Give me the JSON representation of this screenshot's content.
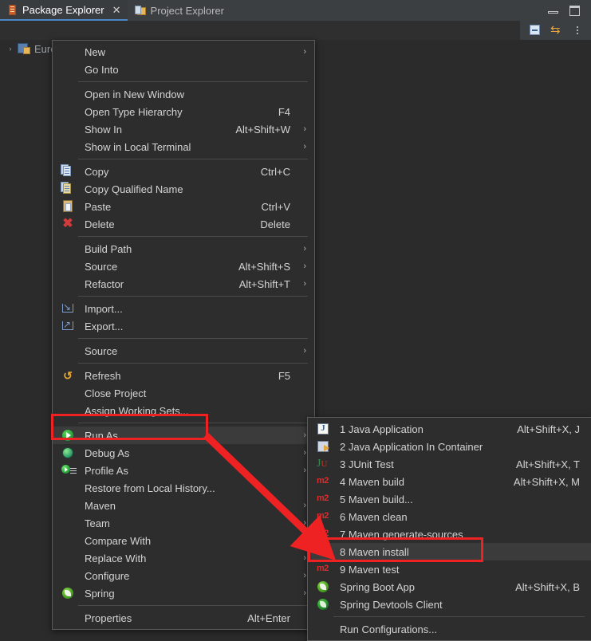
{
  "window": {
    "tabs": [
      {
        "label": "Package Explorer",
        "icon": "package-explorer-icon",
        "active": true,
        "closable": true
      },
      {
        "label": "Project Explorer",
        "icon": "project-explorer-icon",
        "active": false,
        "closable": false
      }
    ],
    "window_controls": [
      {
        "name": "minimize-button",
        "glyph": "minimize-icon"
      },
      {
        "name": "maximize-button",
        "glyph": "maximize-icon"
      }
    ],
    "view_toolbar": [
      {
        "name": "collapse-all-button",
        "icon": "collapse-all-icon"
      },
      {
        "name": "link-with-editor-button",
        "icon": "link-with-editor-icon"
      },
      {
        "name": "view-menu-button",
        "icon": "view-menu-icon"
      }
    ]
  },
  "tree": {
    "items": [
      {
        "label": "EurekaServer [boot] [devtools] [EurekaServer master]",
        "icon": "java-project-icon",
        "expander": "›"
      }
    ]
  },
  "context_menu": {
    "items": [
      {
        "label": "New",
        "accel": "",
        "submenu": true,
        "icon": ""
      },
      {
        "label": "Go Into",
        "accel": "",
        "submenu": false,
        "icon": ""
      },
      {
        "separator": true
      },
      {
        "label": "Open in New Window",
        "accel": "",
        "submenu": false,
        "icon": ""
      },
      {
        "label": "Open Type Hierarchy",
        "accel": "F4",
        "submenu": false,
        "icon": ""
      },
      {
        "label": "Show In",
        "accel": "Alt+Shift+W",
        "submenu": true,
        "icon": ""
      },
      {
        "label": "Show in Local Terminal",
        "accel": "",
        "submenu": true,
        "icon": ""
      },
      {
        "separator": true
      },
      {
        "label": "Copy",
        "accel": "Ctrl+C",
        "submenu": false,
        "icon": "copy-icon"
      },
      {
        "label": "Copy Qualified Name",
        "accel": "",
        "submenu": false,
        "icon": "copy-qualified-name-icon"
      },
      {
        "label": "Paste",
        "accel": "Ctrl+V",
        "submenu": false,
        "icon": "paste-icon"
      },
      {
        "label": "Delete",
        "accel": "Delete",
        "submenu": false,
        "icon": "delete-icon"
      },
      {
        "separator": true
      },
      {
        "label": "Build Path",
        "accel": "",
        "submenu": true,
        "icon": ""
      },
      {
        "label": "Source",
        "accel": "Alt+Shift+S",
        "submenu": true,
        "icon": ""
      },
      {
        "label": "Refactor",
        "accel": "Alt+Shift+T",
        "submenu": true,
        "icon": ""
      },
      {
        "separator": true
      },
      {
        "label": "Import...",
        "accel": "",
        "submenu": false,
        "icon": "import-icon"
      },
      {
        "label": "Export...",
        "accel": "",
        "submenu": false,
        "icon": "export-icon"
      },
      {
        "separator": true
      },
      {
        "label": "Source",
        "accel": "",
        "submenu": true,
        "icon": ""
      },
      {
        "separator": true
      },
      {
        "label": "Refresh",
        "accel": "F5",
        "submenu": false,
        "icon": "refresh-icon"
      },
      {
        "label": "Close Project",
        "accel": "",
        "submenu": false,
        "icon": ""
      },
      {
        "label": "Assign Working Sets...",
        "accel": "",
        "submenu": false,
        "icon": ""
      },
      {
        "separator": true
      },
      {
        "label": "Run As",
        "accel": "",
        "submenu": true,
        "icon": "run-icon",
        "highlighted": true,
        "annotated": true
      },
      {
        "label": "Debug As",
        "accel": "",
        "submenu": true,
        "icon": "debug-icon"
      },
      {
        "label": "Profile As",
        "accel": "",
        "submenu": true,
        "icon": "profile-icon"
      },
      {
        "label": "Restore from Local History...",
        "accel": "",
        "submenu": false,
        "icon": ""
      },
      {
        "label": "Maven",
        "accel": "",
        "submenu": true,
        "icon": ""
      },
      {
        "label": "Team",
        "accel": "",
        "submenu": true,
        "icon": ""
      },
      {
        "label": "Compare With",
        "accel": "",
        "submenu": true,
        "icon": ""
      },
      {
        "label": "Replace With",
        "accel": "",
        "submenu": true,
        "icon": ""
      },
      {
        "label": "Configure",
        "accel": "",
        "submenu": true,
        "icon": ""
      },
      {
        "label": "Spring",
        "accel": "",
        "submenu": true,
        "icon": "spring-icon"
      },
      {
        "separator": true
      },
      {
        "label": "Properties",
        "accel": "Alt+Enter",
        "submenu": false,
        "icon": ""
      }
    ]
  },
  "run_as_submenu": {
    "items": [
      {
        "label": "1 Java Application",
        "accel": "Alt+Shift+X, J",
        "icon": "java-application-icon"
      },
      {
        "label": "2 Java Application In Container",
        "accel": "",
        "icon": "java-container-icon"
      },
      {
        "label": "3 JUnit Test",
        "accel": "Alt+Shift+X, T",
        "icon": "junit-icon"
      },
      {
        "label": "4 Maven build",
        "accel": "Alt+Shift+X, M",
        "icon": "maven-icon"
      },
      {
        "label": "5 Maven build...",
        "accel": "",
        "icon": "maven-icon"
      },
      {
        "label": "6 Maven clean",
        "accel": "",
        "icon": "maven-icon"
      },
      {
        "label": "7 Maven generate-sources",
        "accel": "",
        "icon": "maven-icon"
      },
      {
        "label": "8 Maven install",
        "accel": "",
        "icon": "maven-icon",
        "highlighted": true,
        "annotated": true
      },
      {
        "label": "9 Maven test",
        "accel": "",
        "icon": "maven-icon"
      },
      {
        "label": "Spring Boot App",
        "accel": "Alt+Shift+X, B",
        "icon": "spring-boot-icon"
      },
      {
        "label": "Spring Devtools Client",
        "accel": "",
        "icon": "spring-devtools-icon"
      },
      {
        "separator": true
      },
      {
        "label": "Run Configurations...",
        "accel": "",
        "icon": ""
      }
    ]
  },
  "annotations": {
    "color": "#ee2222",
    "boxes": [
      {
        "name": "run-as-highlight-box",
        "target": "Run As"
      },
      {
        "name": "maven-install-highlight-box",
        "target": "8 Maven install"
      }
    ],
    "arrow": {
      "name": "pointer-arrow",
      "from": "Run As",
      "to": "8 Maven install"
    }
  }
}
